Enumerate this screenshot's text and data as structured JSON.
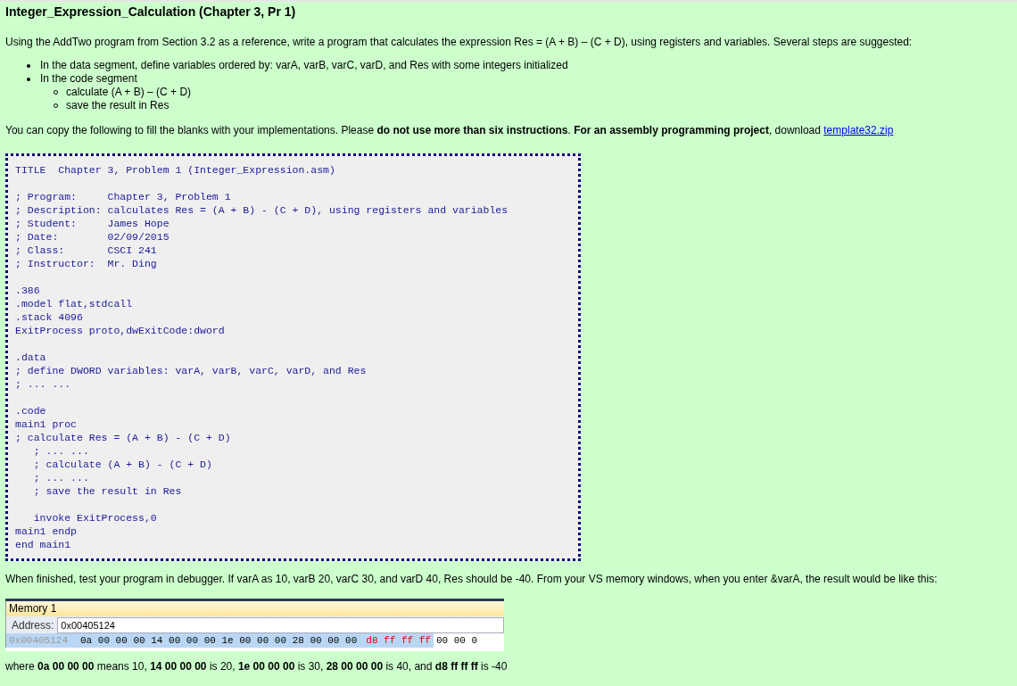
{
  "title": "Integer_Expression_Calculation (Chapter 3, Pr 1)",
  "intro": "Using the AddTwo program from Section 3.2 as a reference, write a program that calculates the expression Res = (A + B) – (C + D), using registers and variables. Several steps are suggested:",
  "steps": [
    {
      "text": "In the data segment, define variables ordered by: varA, varB, varC, varD, and Res with some integers initialized"
    },
    {
      "text": "In the code segment",
      "children": [
        {
          "text": "calculate (A + B) – (C + D)"
        },
        {
          "text": "save the result in Res"
        }
      ]
    }
  ],
  "copy_note": {
    "text": "You can copy the following to fill the blanks with your implementations. Please **do not use more than six instructions**. **For an assembly programming project**, download",
    "link": "template32.zip"
  },
  "code": "TITLE  Chapter 3, Problem 1 (Integer_Expression.asm)\n\n; Program:     Chapter 3, Problem 1\n; Description: calculates Res = (A + B) - (C + D), using registers and variables\n; Student:     James Hope\n; Date:        02/09/2015\n; Class:       CSCI 241\n; Instructor:  Mr. Ding\n\n.386\n.model flat,stdcall\n.stack 4096\nExitProcess proto,dwExitCode:dword\n\n.data\n; define DWORD variables: varA, varB, varC, varD, and Res\n; ... ...\n\n.code\nmain1 proc\n; calculate Res = (A + B) - (C + D)\n   ; ... ...\n   ; calculate (A + B) - (C + D)\n   ; ... ...\n   ; save the result in Res\n\n   invoke ExitProcess,0\nmain1 endp\nend main1",
  "finished_note": "When finished, test your program in debugger. If varA as 10, varB 20, varC 30, and varD 40, Res should be -40. From your VS memory windows, when you enter &varA, the result would be like this:",
  "memory_window": {
    "title": "Memory 1",
    "address_label": "Address:",
    "address_value": "0x00405124",
    "row": {
      "address": "0x00405124",
      "segments": [
        {
          "text": "0a 00 00 00 14 00 00 00 1e 00 00 00 28 00 00 00",
          "changed": false,
          "selected": true
        },
        {
          "text": "d8 ff ff ff",
          "changed": true,
          "selected": true
        },
        {
          "text": "00 00 0",
          "changed": false,
          "selected": false
        }
      ]
    }
  },
  "explanation": "where **0a 00 00 00** means 10, **14 00 00 00** is 20, **1e 00 00 00** is 30, **28 00 00 00** is 40, and **d8 ff ff ff** is -40"
}
